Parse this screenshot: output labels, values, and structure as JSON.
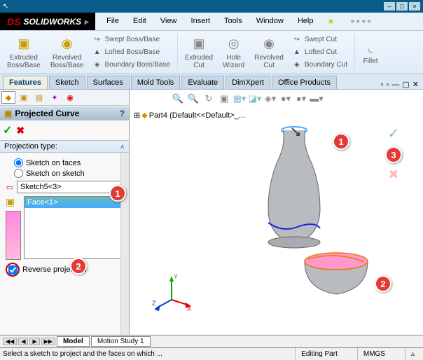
{
  "window": {
    "app_title": "SOLIDWORKS"
  },
  "menu": [
    "File",
    "Edit",
    "View",
    "Insert",
    "Tools",
    "Window",
    "Help"
  ],
  "ribbon": {
    "extruded_boss": "Extruded\nBoss/Base",
    "revolved_boss": "Revolved\nBoss/Base",
    "swept_boss": "Swept Boss/Base",
    "lofted_boss": "Lofted Boss/Base",
    "boundary_boss": "Boundary Boss/Base",
    "extruded_cut": "Extruded\nCut",
    "hole_wizard": "Hole\nWizard",
    "revolved_cut": "Revolved\nCut",
    "swept_cut": "Swept Cut",
    "lofted_cut": "Lofted Cut",
    "boundary_cut": "Boundary Cut",
    "fillet": "Fillet"
  },
  "tabs": [
    "Features",
    "Sketch",
    "Surfaces",
    "Mold Tools",
    "Evaluate",
    "DimXpert",
    "Office Products"
  ],
  "feature_panel": {
    "title": "Projected Curve",
    "section": "Projection type:",
    "opt_faces": "Sketch on faces",
    "opt_sketch": "Sketch on sketch",
    "sketch_input": "Sketch5<3>",
    "face_sel": "Face<1>",
    "reverse": "Reverse projection"
  },
  "tree": {
    "root": "Part4 (Default<<Default>_..."
  },
  "bottom_tabs": {
    "model": "Model",
    "motion": "Motion Study 1"
  },
  "status": {
    "msg": "Select a sketch to project and the faces on which ...",
    "mode": "Editing Part",
    "units": "MMGS"
  },
  "callouts": {
    "c1": "1",
    "c2": "2",
    "c3": "3"
  }
}
